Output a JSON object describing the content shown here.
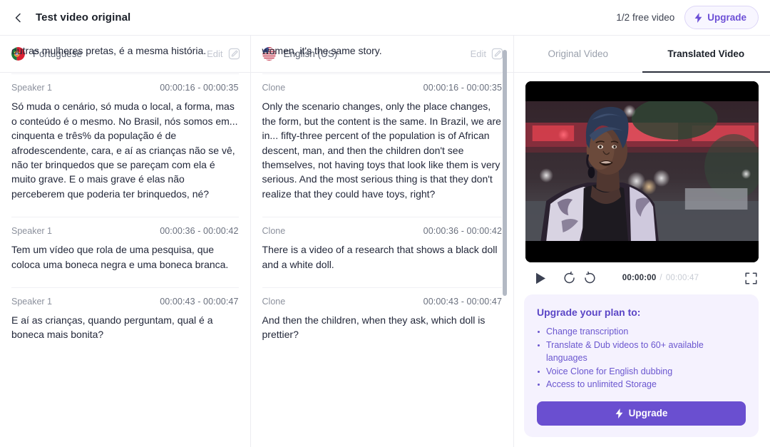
{
  "header": {
    "back_icon": "chevron-left-icon",
    "title": "Test video original",
    "free_videos": "1/2 free video",
    "upgrade_label": "Upgrade",
    "upgrade_icon": "bolt-icon"
  },
  "columns": [
    {
      "flag": "portugal-flag-icon",
      "language": "Portuguese",
      "edit_label": "Edit",
      "edit_icon": "pencil-square-icon",
      "segments": [
        {
          "speaker": "",
          "times": "",
          "text": "outras mulheres pretas, é a mesma história."
        },
        {
          "speaker": "Speaker 1",
          "times": "00:00:16 - 00:00:35",
          "text": "Só muda o cenário, só muda o local, a forma, mas o conteúdo é o mesmo. No Brasil, nós somos em... cinquenta e três% da população é de afrodescendente, cara, e aí as crianças não se vê, não ter brinquedos que se pareçam com ela é muito grave. E o mais grave é elas não perceberem que poderia ter brinquedos, né?"
        },
        {
          "speaker": "Speaker 1",
          "times": "00:00:36 - 00:00:42",
          "text": "Tem um vídeo que rola de uma pesquisa, que coloca uma boneca negra e uma boneca branca."
        },
        {
          "speaker": "Speaker 1",
          "times": "00:00:43 - 00:00:47",
          "text": "E aí as crianças, quando perguntam, qual é a boneca mais bonita?"
        }
      ]
    },
    {
      "flag": "usa-flag-icon",
      "language": "English (US)",
      "edit_label": "Edit",
      "edit_icon": "pencil-square-icon",
      "segments": [
        {
          "speaker": "",
          "times": "",
          "text": "women, it's the same story."
        },
        {
          "speaker": "Clone",
          "times": "00:00:16 - 00:00:35",
          "text": "Only the scenario changes, only the place changes, the form, but the content is the same. In Brazil, we are in... fifty-three percent of the population is of African descent, man, and then the children don't see themselves, not having toys that look like them is very serious. And the most serious thing is that they don't realize that they could have toys, right?"
        },
        {
          "speaker": "Clone",
          "times": "00:00:36 - 00:00:42",
          "text": "There is a video of a research that shows a black doll and a white doll."
        },
        {
          "speaker": "Clone",
          "times": "00:00:43 - 00:00:47",
          "text": "And then the children, when they ask, which doll is prettier?"
        }
      ]
    }
  ],
  "right_panel": {
    "tabs": [
      {
        "label": "Original Video",
        "active": false
      },
      {
        "label": "Translated Video",
        "active": true
      }
    ],
    "player": {
      "play_icon": "play-icon",
      "rewind_icon": "rewind-10-icon",
      "forward_icon": "forward-10-icon",
      "fullscreen_icon": "fullscreen-icon",
      "current_time": "00:00:00",
      "separator": "/",
      "total_time": "00:00:47"
    },
    "upgrade_card": {
      "title": "Upgrade your plan to:",
      "benefits": [
        "Change transcription",
        "Translate & Dub videos to 60+ available languages",
        "Voice Clone for English dubbing",
        "Access to unlimited Storage"
      ],
      "cta_label": "Upgrade",
      "cta_icon": "bolt-icon"
    }
  },
  "colors": {
    "accent": "#6a4fd0",
    "accent_light": "#f5f2fe",
    "text": "#23283a",
    "muted": "#8c919d"
  }
}
